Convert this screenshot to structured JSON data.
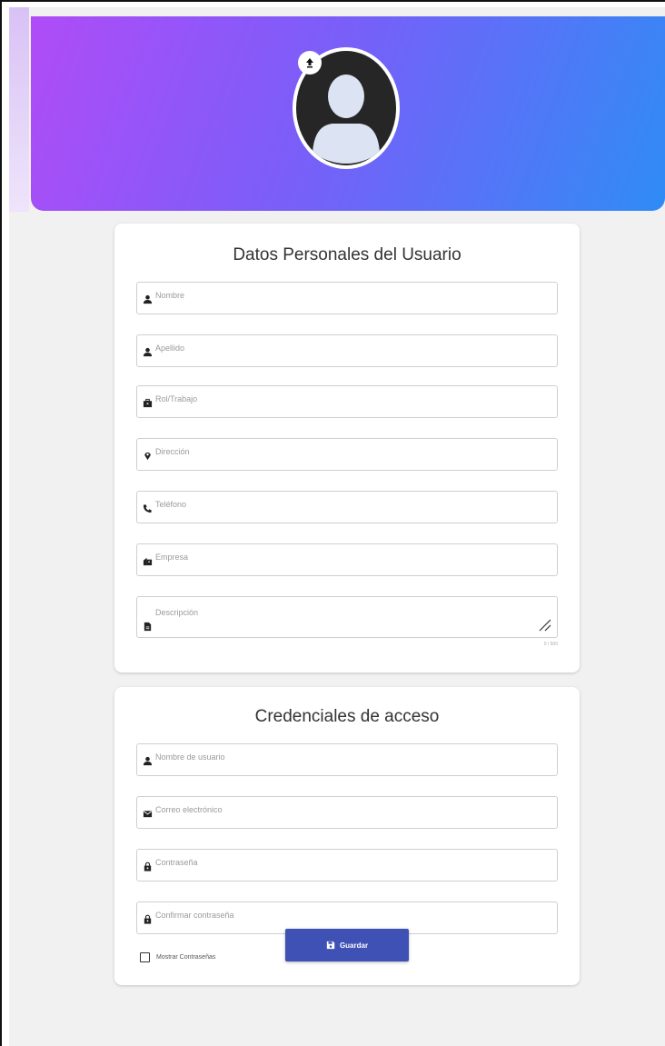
{
  "header": {
    "avatar_icon": "user-avatar-icon",
    "upload_icon": "upload-arrow-icon",
    "gradient": [
      "#b04cf7",
      "#2f8cf6"
    ]
  },
  "personal": {
    "title": "Datos Personales del Usuario",
    "fields": {
      "nombre": {
        "placeholder": "Nombre",
        "icon": "person-icon"
      },
      "apellido": {
        "placeholder": "Apellido",
        "icon": "person-icon"
      },
      "rol": {
        "placeholder": "Rol/Trabajo",
        "icon": "briefcase-icon"
      },
      "direccion": {
        "placeholder": "Dirección",
        "icon": "location-pin-icon"
      },
      "telefono": {
        "placeholder": "Teléfono",
        "icon": "phone-icon"
      },
      "empresa": {
        "placeholder": "Empresa",
        "icon": "building-icon"
      },
      "descripcion": {
        "placeholder": "Descripción",
        "icon": "document-icon",
        "counter": "0 / 500"
      }
    }
  },
  "credentials": {
    "title": "Credenciales de acceso",
    "fields": {
      "usuario": {
        "placeholder": "Nombre de usuario",
        "icon": "person-icon"
      },
      "correo": {
        "placeholder": "Correo electrónico",
        "icon": "mail-icon"
      },
      "password": {
        "placeholder": "Contraseña",
        "icon": "lock-icon"
      },
      "confirm": {
        "placeholder": "Confirmar contraseña",
        "icon": "lock-icon"
      }
    },
    "show_passwords_label": "Mostrar Contraseñas",
    "show_passwords_checked": false
  },
  "actions": {
    "save_label": "Guardar",
    "save_icon": "save-icon",
    "save_color": "#3f51b5"
  }
}
